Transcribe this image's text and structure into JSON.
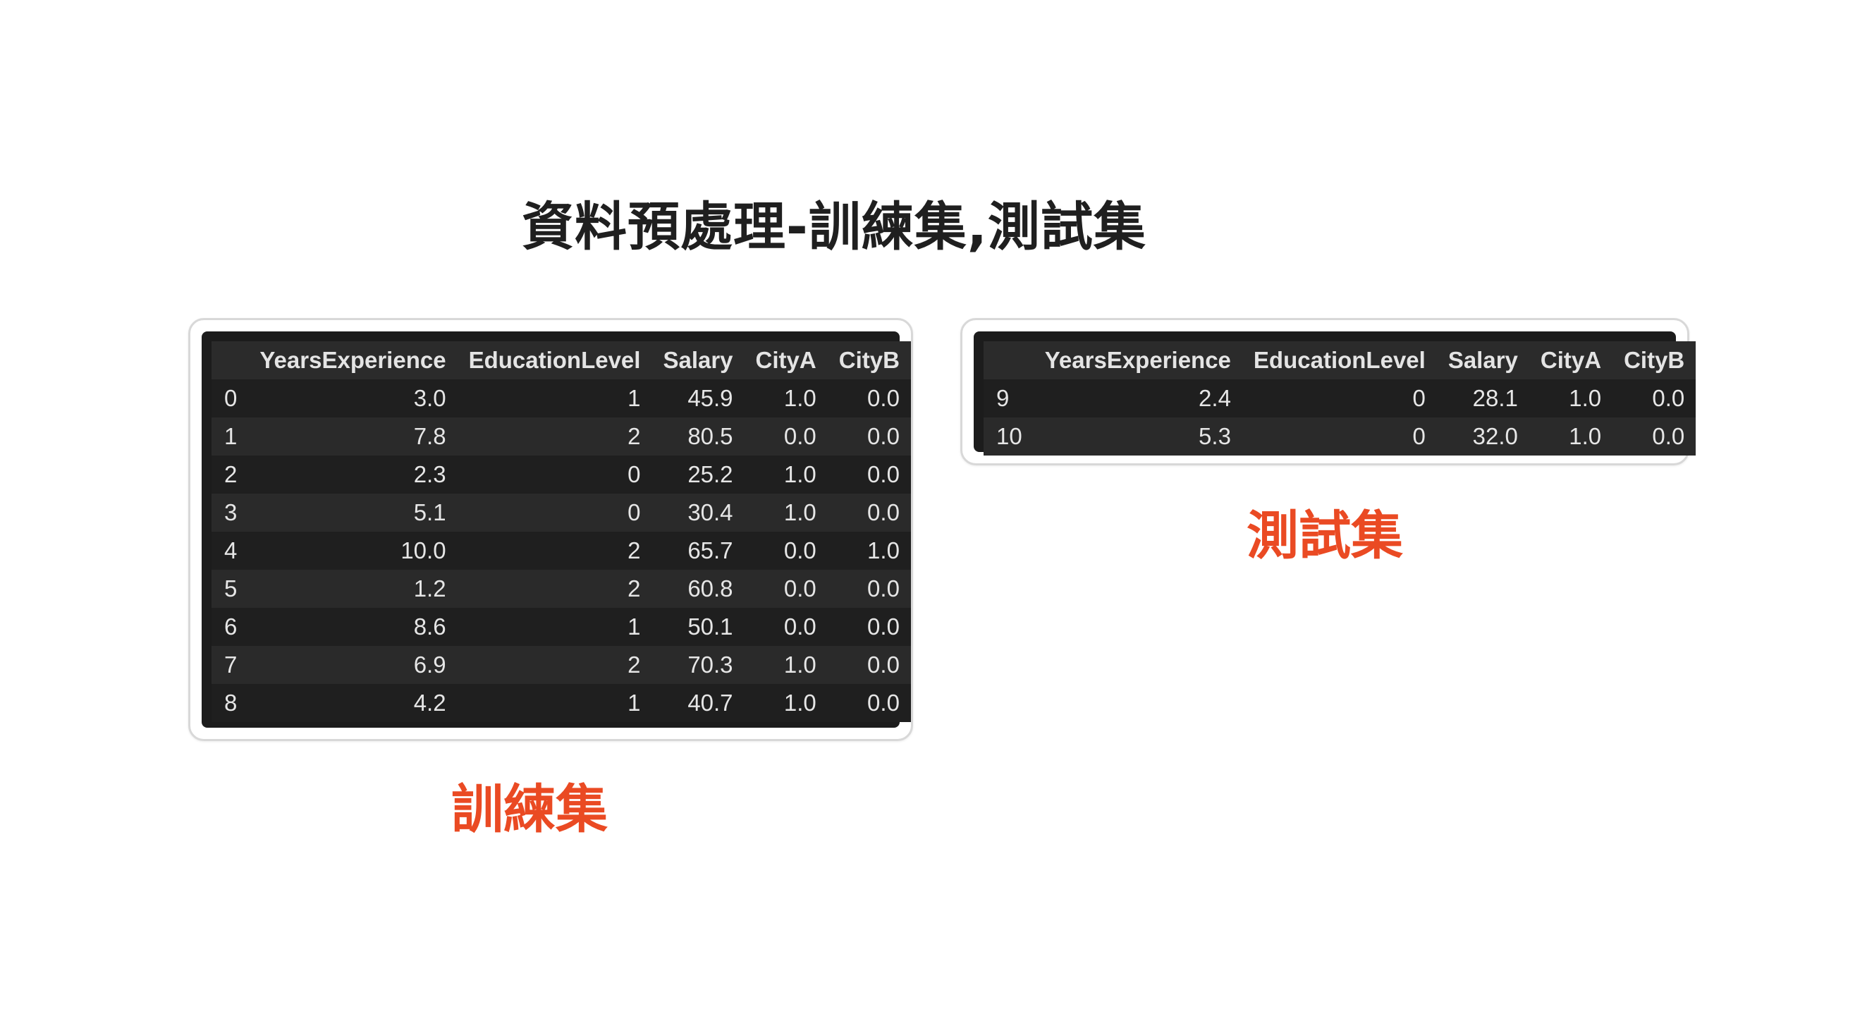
{
  "title": "資料預處理-訓練集,測試集",
  "accent_color": "#ea4a23",
  "train": {
    "label": "訓練集",
    "columns": [
      "",
      "YearsExperience",
      "EducationLevel",
      "Salary",
      "CityA",
      "CityB"
    ],
    "rows": [
      [
        "0",
        "3.0",
        "1",
        "45.9",
        "1.0",
        "0.0"
      ],
      [
        "1",
        "7.8",
        "2",
        "80.5",
        "0.0",
        "0.0"
      ],
      [
        "2",
        "2.3",
        "0",
        "25.2",
        "1.0",
        "0.0"
      ],
      [
        "3",
        "5.1",
        "0",
        "30.4",
        "1.0",
        "0.0"
      ],
      [
        "4",
        "10.0",
        "2",
        "65.7",
        "0.0",
        "1.0"
      ],
      [
        "5",
        "1.2",
        "2",
        "60.8",
        "0.0",
        "0.0"
      ],
      [
        "6",
        "8.6",
        "1",
        "50.1",
        "0.0",
        "0.0"
      ],
      [
        "7",
        "6.9",
        "2",
        "70.3",
        "1.0",
        "0.0"
      ],
      [
        "8",
        "4.2",
        "1",
        "40.7",
        "1.0",
        "0.0"
      ]
    ]
  },
  "test": {
    "label": "測試集",
    "columns": [
      "",
      "YearsExperience",
      "EducationLevel",
      "Salary",
      "CityA",
      "CityB"
    ],
    "rows": [
      [
        "9",
        "2.4",
        "0",
        "28.1",
        "1.0",
        "0.0"
      ],
      [
        "10",
        "5.3",
        "0",
        "32.0",
        "1.0",
        "0.0"
      ]
    ]
  }
}
